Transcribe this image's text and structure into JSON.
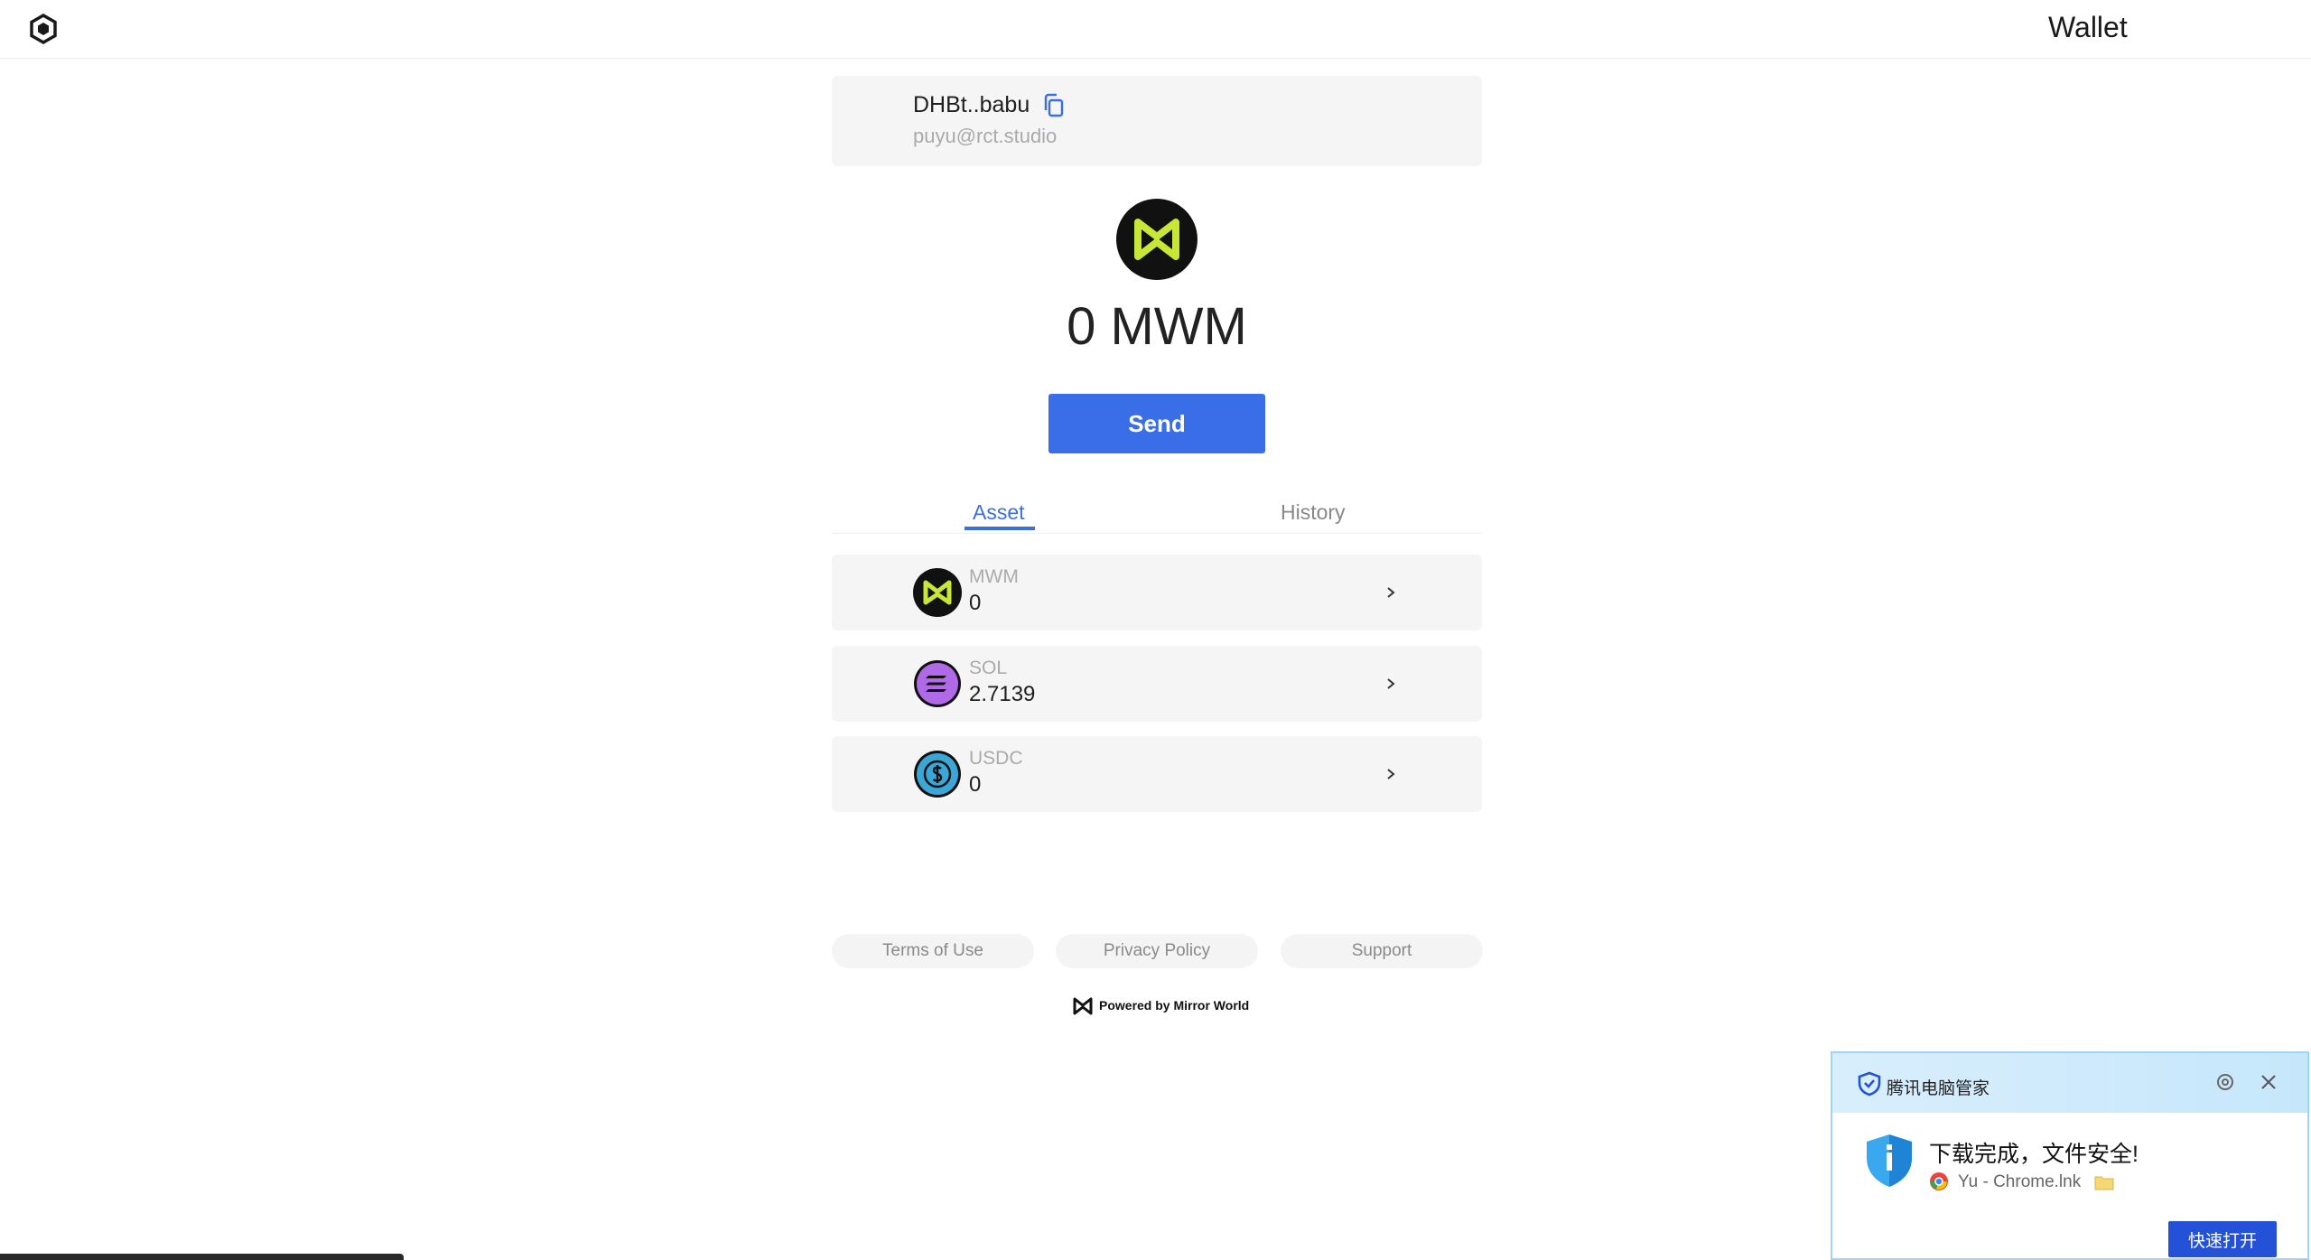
{
  "header": {
    "title": "Wallet",
    "logo_icon": "hexagon-logo-icon"
  },
  "account": {
    "address": "DHBt..babu",
    "email": "puyu@rct.studio"
  },
  "balance": {
    "amount": "0 MWM"
  },
  "actions": {
    "send_label": "Send"
  },
  "tabs": [
    {
      "label": "Asset",
      "active": true
    },
    {
      "label": "History",
      "active": false
    }
  ],
  "assets": [
    {
      "symbol": "MWM",
      "amount": "0",
      "icon": "mwm-token-icon",
      "color": "#c8e636"
    },
    {
      "symbol": "SOL",
      "amount": "2.7139",
      "icon": "sol-token-icon",
      "color": "#b06ae8"
    },
    {
      "symbol": "USDC",
      "amount": "0",
      "icon": "usdc-token-icon",
      "color": "#3aa7d6"
    }
  ],
  "footer": {
    "links": [
      "Terms of Use",
      "Privacy Policy",
      "Support"
    ],
    "powered_by": "Powered by Mirror World"
  },
  "popup": {
    "brand": "腾讯电脑管家",
    "message": "下载完成，文件安全!",
    "file": "Yu - Chrome.lnk",
    "open_button": "快速打开"
  },
  "colors": {
    "accent": "#3a6ee8",
    "popup_button": "#2352d8"
  }
}
